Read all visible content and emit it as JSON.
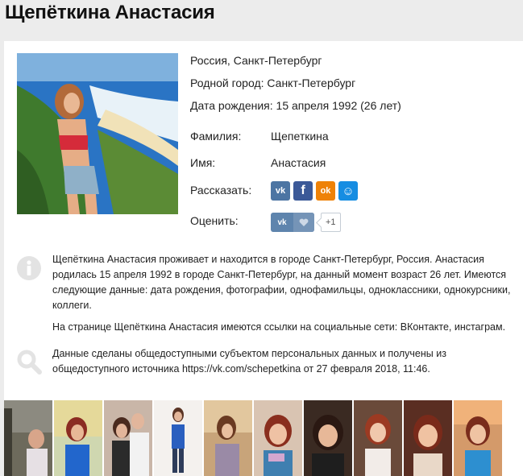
{
  "profile": {
    "name": "Щепёткина Анастасия",
    "location": "Россия, Санкт-Петербург",
    "hometown": "Родной город: Санкт-Петербург",
    "birthdate": "Дата рождения: 15 апреля 1992 (26 лет)",
    "surname_label": "Фамилия:",
    "surname_value": "Щепеткина",
    "firstname_label": "Имя:",
    "firstname_value": "Анастасия",
    "share_label": "Рассказать:",
    "rate_label": "Оценить:",
    "like_count": "+1"
  },
  "share_buttons": [
    {
      "network": "vk",
      "glyph": "vk",
      "color": "#4c75a3"
    },
    {
      "network": "facebook",
      "glyph": "f",
      "color": "#3b5998"
    },
    {
      "network": "odnoklassniki",
      "glyph": "ok",
      "color": "#ee8208"
    },
    {
      "network": "mail",
      "glyph": "☺",
      "color": "#168de2"
    }
  ],
  "about": {
    "paragraph1": "Щепёткина Анастасия проживает и находится в городе Санкт-Петербург, Россия. Анастасия родилась 15 апреля 1992 в городе Санкт-Петербург, на данный момент возраст 26 лет. Имеются следующие данные: дата рождения, фотографии, однофамильцы, одноклассники, однокурсники, коллеги.",
    "paragraph2": "На странице Щепёткина Анастасия имеются ссылки на социальные сети: ВКонтакте, инстаграм.",
    "source": "Данные сделаны общедоступными субъектом персональных данных и получены из общедоступного источника https://vk.com/schepetkina от 27 февраля 2018, 11:46."
  },
  "icons": {
    "info": "info-icon",
    "search": "search-icon",
    "vk_like": "vk-logo-icon",
    "heart": "heart-icon"
  },
  "colors": {
    "vk_blue": "#5e84ad",
    "icon_gray": "#e3e3e3"
  }
}
